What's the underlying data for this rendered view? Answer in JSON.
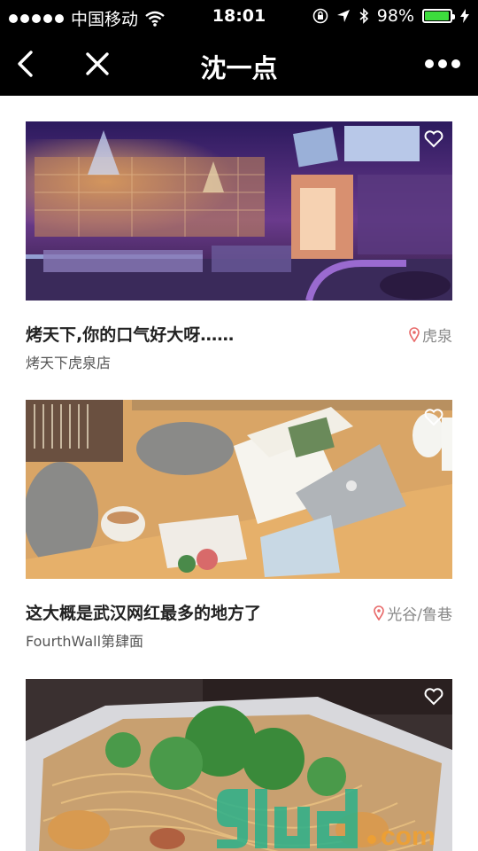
{
  "status": {
    "carrier": "中国移动",
    "time": "18:01",
    "battery": "98%",
    "battery_level": 0.98
  },
  "nav": {
    "title": "沈一点"
  },
  "posts": [
    {
      "title": "烤天下,你的口气好大呀……",
      "location": "虎泉",
      "shop": "烤天下虎泉店"
    },
    {
      "title": "这大概是武汉网红最多的地方了",
      "location": "光谷/鲁巷",
      "shop": "FourthWall第肆面"
    },
    {}
  ],
  "icons": [
    "back-icon",
    "close-icon",
    "more-icon",
    "heart-icon",
    "location-pin-icon",
    "wifi-icon",
    "bluetooth-icon",
    "battery-icon"
  ],
  "colors": {
    "nav_bg": "#000000",
    "battery_fill": "#3ddc3d",
    "pin": "#e86a6a"
  }
}
